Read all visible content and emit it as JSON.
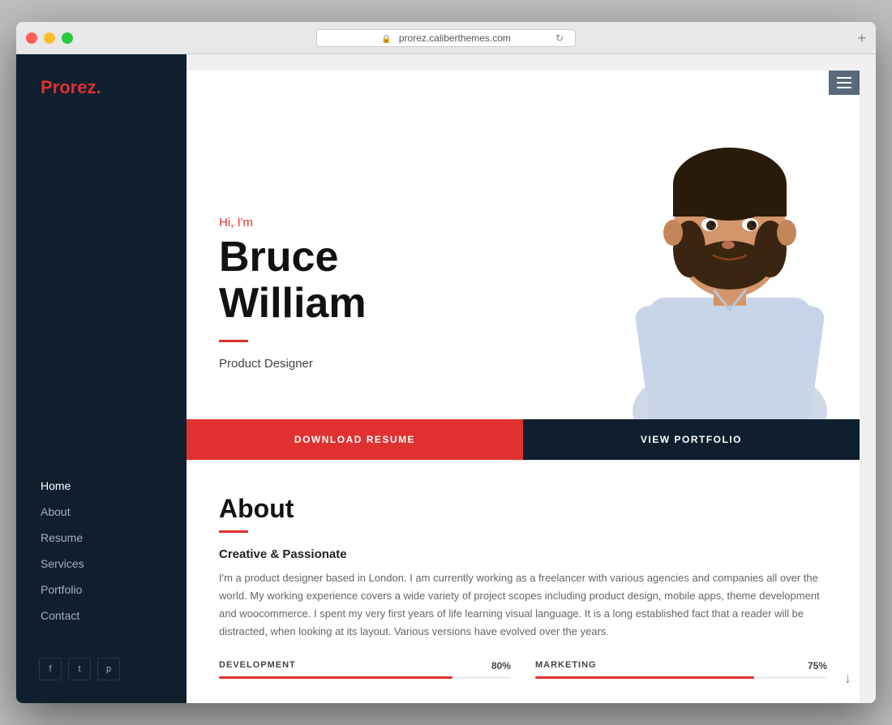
{
  "window": {
    "url": "prorez.caliberthemes.com",
    "lock_icon": "🔒",
    "refresh_icon": "↻",
    "add_tab": "+"
  },
  "sidebar": {
    "logo_text": "Prorez",
    "logo_dot": ".",
    "nav_items": [
      {
        "label": "Home",
        "active": false
      },
      {
        "label": "About",
        "active": false
      },
      {
        "label": "Resume",
        "active": false
      },
      {
        "label": "Services",
        "active": false
      },
      {
        "label": "Portfolio",
        "active": false
      },
      {
        "label": "Contact",
        "active": false
      }
    ],
    "social": [
      {
        "icon": "f",
        "name": "facebook"
      },
      {
        "icon": "t",
        "name": "twitter"
      },
      {
        "icon": "p",
        "name": "pinterest"
      }
    ]
  },
  "hero": {
    "greeting": "Hi, I'm",
    "name_line1": "Bruce",
    "name_line2": "William",
    "title": "Product Designer",
    "cta_download": "DOWNLOAD RESUME",
    "cta_portfolio": "VIEW PORTFOLIO"
  },
  "about": {
    "section_title": "About",
    "subtitle": "Creative & Passionate",
    "body": "I'm a product designer based in London. I am currently working as a freelancer with various agencies and companies all over the world. My working experience covers a wide variety of project scopes including product design, mobile apps, theme development and woocommerce. I spent my very first years of life learning visual language. It is a long established fact that a reader will be distracted, when looking at its layout. Various versions have evolved over the years.",
    "skills": [
      {
        "label": "DEVELOPMENT",
        "percent": 80,
        "display": "80%"
      },
      {
        "label": "MARKETING",
        "percent": 75,
        "display": "75%"
      }
    ]
  },
  "hamburger_icon": "≡",
  "colors": {
    "accent": "#e03030",
    "dark": "#0f1f2e",
    "text": "#444"
  }
}
